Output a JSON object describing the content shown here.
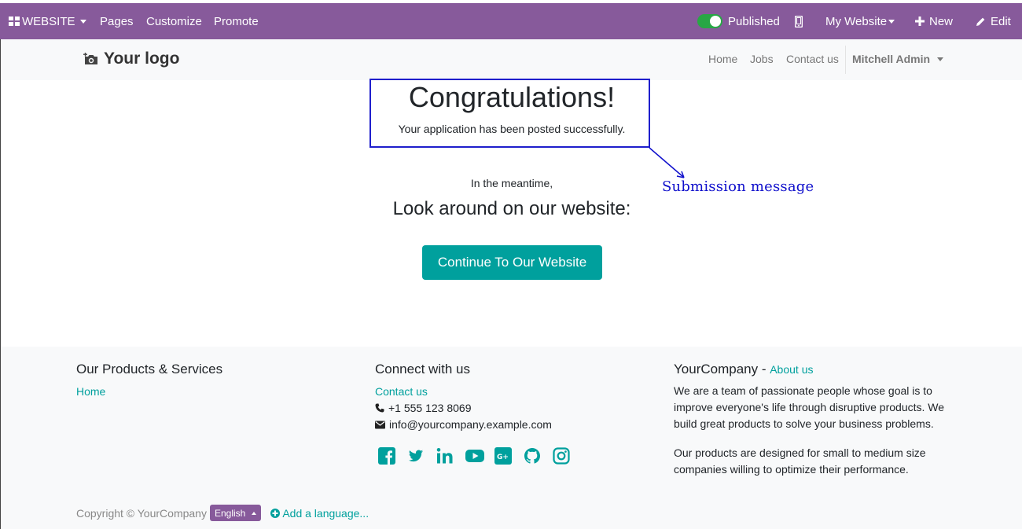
{
  "adminbar": {
    "app_menu": "WEBSITE",
    "pages": "Pages",
    "customize": "Customize",
    "promote": "Promote",
    "published": "Published",
    "my_website": "My Website",
    "new": "New",
    "edit": "Edit",
    "published_on": true
  },
  "header": {
    "logo": "Your logo",
    "nav": [
      "Home",
      "Jobs",
      "Contact us"
    ],
    "user": "Mitchell Admin"
  },
  "main": {
    "title": "Congratulations!",
    "subtitle": "Your application has been posted successfully.",
    "meantime": "In the meantime,",
    "look_around": "Look around on our website:",
    "continue_button": "Continue To Our Website",
    "annotation": "Submission  message"
  },
  "footer": {
    "col1_title": "Our Products & Services",
    "col1_link": "Home",
    "col2_title": "Connect with us",
    "col2_link": "Contact us",
    "phone": "+1 555 123 8069",
    "email": "info@yourcompany.example.com",
    "social_icons": [
      "facebook-icon",
      "twitter-icon",
      "linkedin-icon",
      "youtube-icon",
      "google-plus-icon",
      "github-icon",
      "instagram-icon"
    ],
    "col3_title": "YourCompany",
    "col3_sep": " - ",
    "col3_link": "About us",
    "col3_p1": "We are a team of passionate people whose goal is to improve everyone's life through disruptive products. We build great products to solve your business problems.",
    "col3_p2": "Our products are designed for small to medium size companies willing to optimize their performance.",
    "copyright": "Copyright © YourCompany",
    "language": "English",
    "add_language": "Add a language..."
  },
  "colors": {
    "brand": "#875a9b",
    "accent": "#00a09d",
    "annotation": "#1010cc"
  }
}
